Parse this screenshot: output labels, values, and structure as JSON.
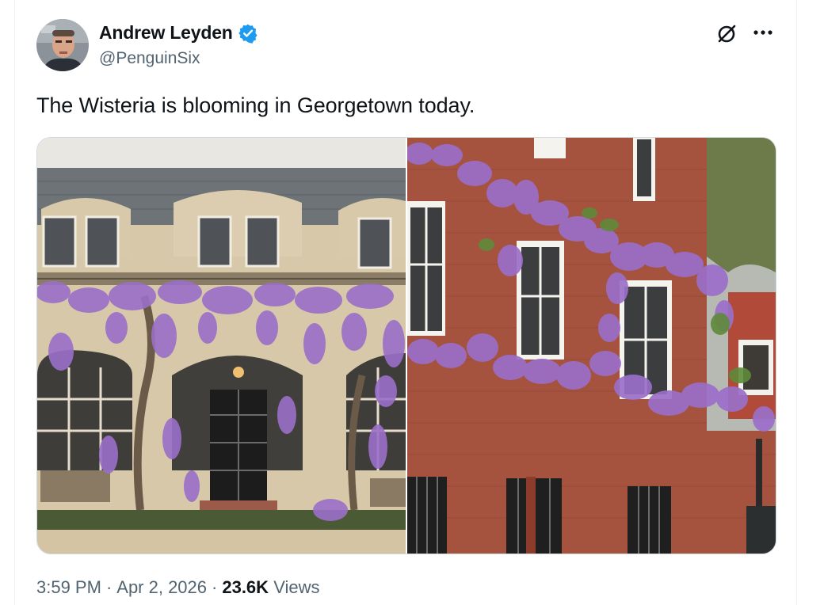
{
  "tweet": {
    "author": {
      "display_name": "Andrew Leyden",
      "handle": "@PenguinSix",
      "verified": true,
      "verified_color": "#1d9bf0",
      "avatar_icon": "user-avatar-photo"
    },
    "text": "The Wisteria is blooming in Georgetown today.",
    "media": [
      {
        "icon": "photo-stone-house-with-wisteria"
      },
      {
        "icon": "photo-brick-building-with-wisteria"
      }
    ],
    "actions": {
      "grok_icon": "grok-icon",
      "more_icon": "more-options-icon"
    },
    "meta": {
      "time": "3:59 PM",
      "separator": "·",
      "date": "Apr 2, 2026",
      "views_count": "23.6K",
      "views_label": "Views"
    }
  },
  "colors": {
    "text_primary": "#0f1419",
    "text_secondary": "#536471",
    "border": "#cfd9de",
    "wisteria": "#9b6fc9",
    "brick": "#a5533f"
  }
}
